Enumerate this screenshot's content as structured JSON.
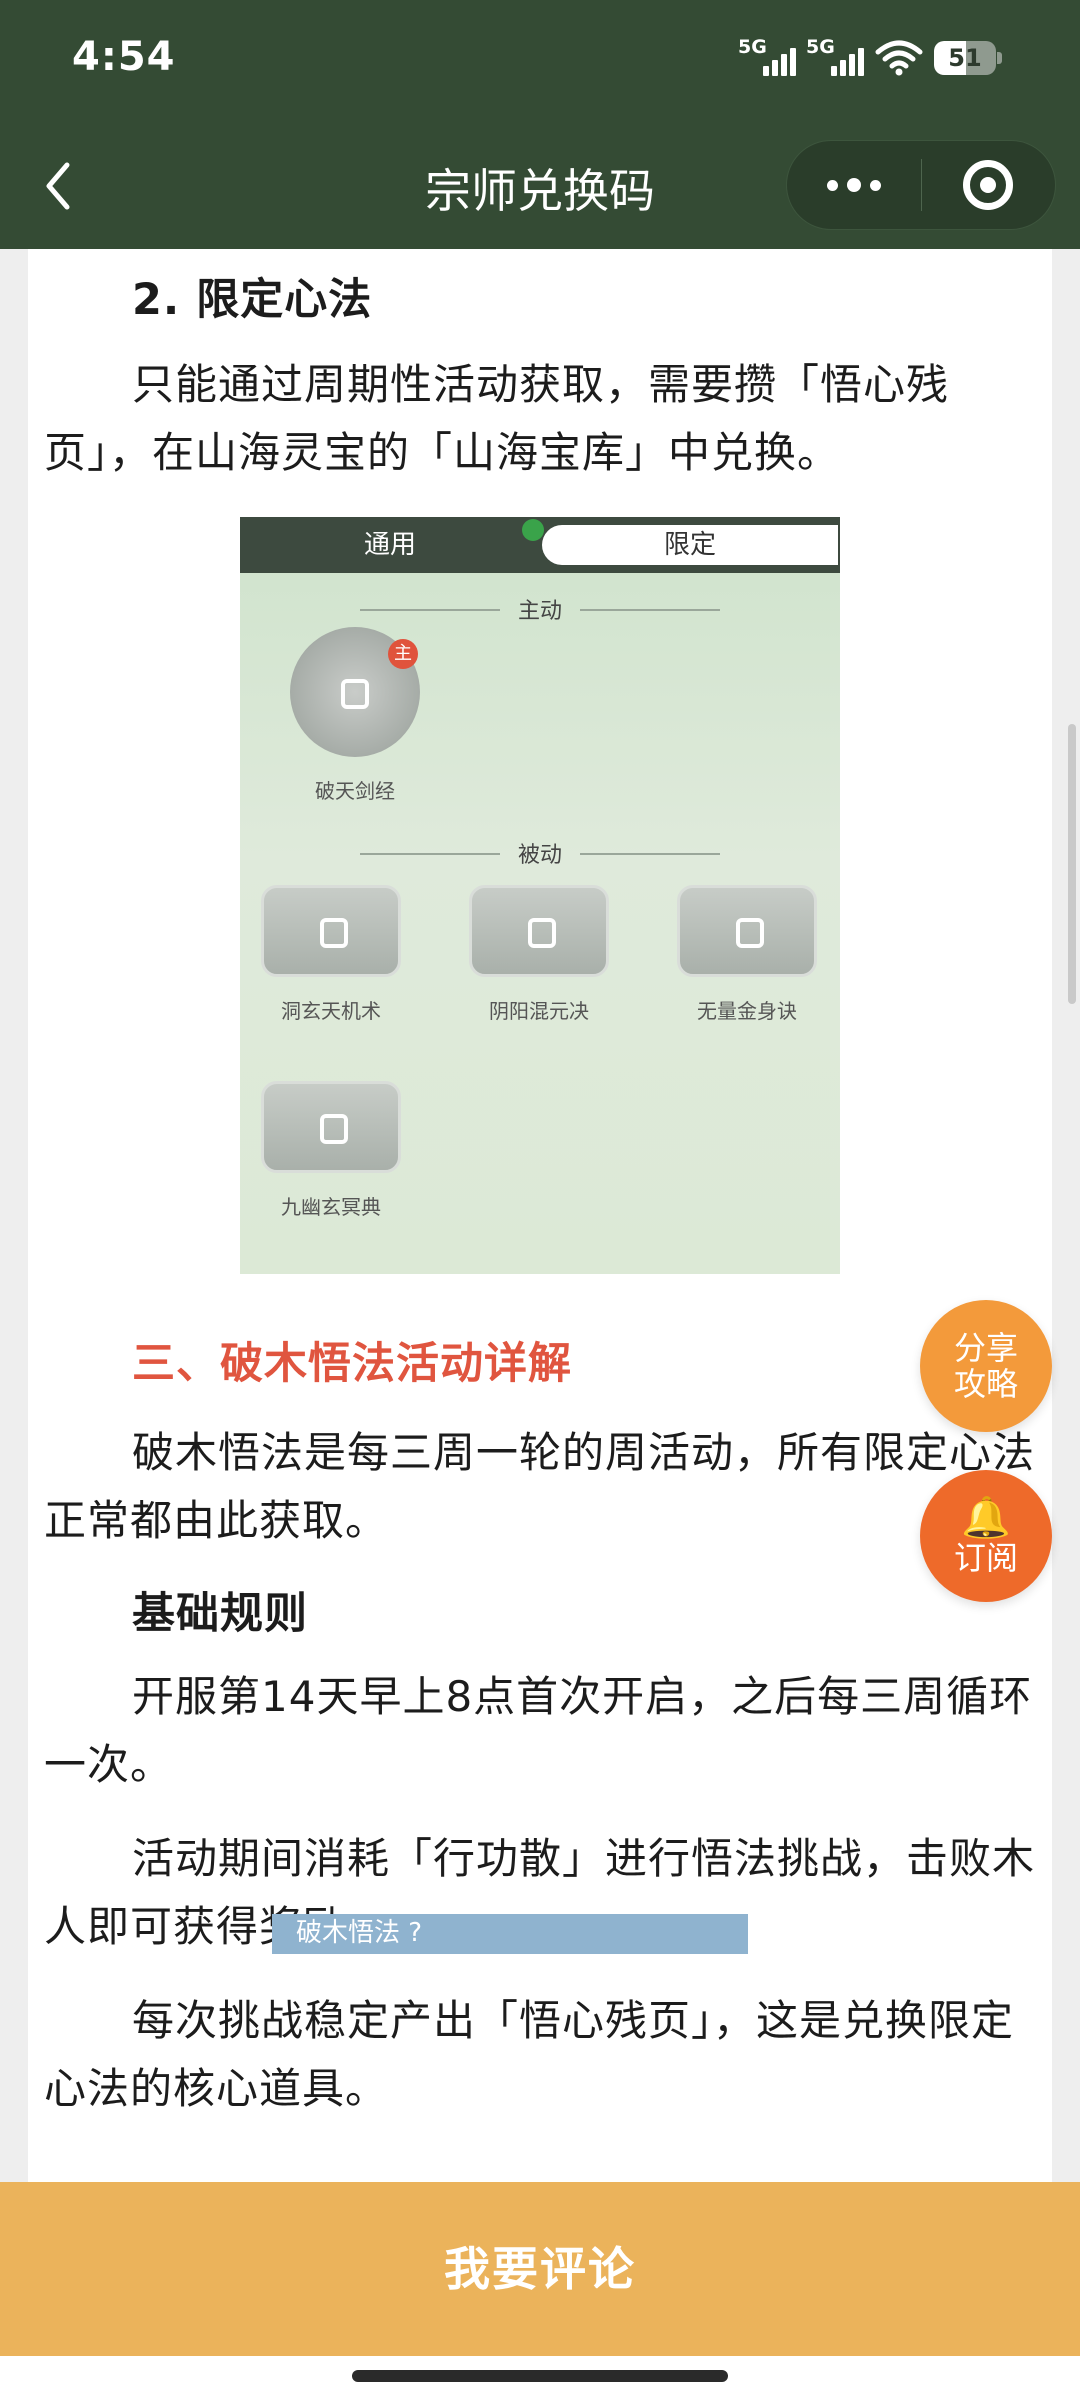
{
  "status_bar": {
    "time": "4:54",
    "net1": "5G",
    "net2": "5G",
    "battery": "51",
    "battery_level": 0.51
  },
  "nav": {
    "title": "宗师兑换码"
  },
  "article": {
    "h_limited": "2. 限定心法",
    "p_limited": "只能通过周期性活动获取，需要攒「悟心残页」，在山海灵宝的「山海宝库」中兑换。",
    "image1": {
      "tab_general": "通用",
      "tab_limited": "限定",
      "section_active": "主动",
      "active_items": [
        {
          "name": "破天剑经",
          "badge": "主"
        }
      ],
      "section_passive": "被动",
      "passive_items": [
        {
          "name": "洞玄天机术"
        },
        {
          "name": "阴阳混元决"
        },
        {
          "name": "无量金身诀"
        },
        {
          "name": "九幽玄冥典"
        }
      ]
    },
    "h_section3": "三、破木悟法活动详解",
    "p_intro": "破木悟法是每三周一轮的周活动，所有限定心法正常都由此获取。",
    "h_basic": "基础规则",
    "p_rule1": "开服第14天早上8点首次开启，之后每三周循环一次。",
    "p_rule2": "活动期间消耗「行功散」进行悟法挑战，击败木人即可获得奖励。",
    "p_rule3": "每次挑战稳定产出「悟心残页」，这是兑换限定心法的核心道具。",
    "image2_caption": "破木悟法 ?"
  },
  "floating": {
    "share": "分享攻略",
    "subscribe": "订阅"
  },
  "comment": {
    "label": "我要评论"
  }
}
